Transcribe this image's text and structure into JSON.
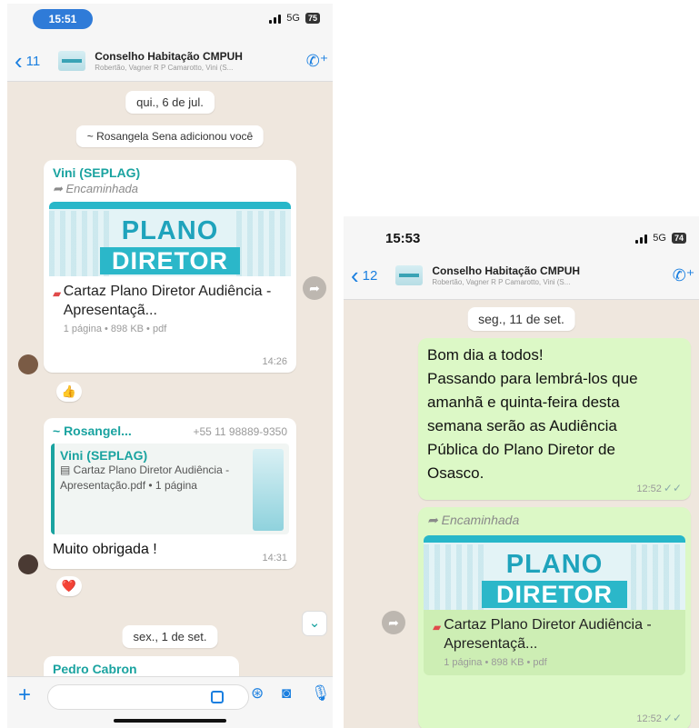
{
  "left": {
    "status": {
      "time": "15:51",
      "network": "5G",
      "battery": "75"
    },
    "header": {
      "back_count": "11",
      "group_name": "Conselho Habitação CMPUH",
      "members": "Robertão, Vagner R P Camarotto, Vini (S..."
    },
    "date_pill_1": "qui., 6 de jul.",
    "system_msg": "~ Rosangela Sena adicionou você",
    "msg1": {
      "sender": "Vini (SEPLAG)",
      "forwarded": "Encaminhada",
      "poster_line1": "PLANO",
      "poster_line2": "DIRETOR",
      "doc_title": "Cartaz Plano Diretor Audiência - Apresentaçã...",
      "doc_meta": "1 página • 898 KB • pdf",
      "time": "14:26",
      "reaction": "👍"
    },
    "msg2": {
      "sender": "~ Rosangel...",
      "phone": "+55 11 98889-9350",
      "quote_author": "Vini (SEPLAG)",
      "quote_text": "Cartaz Plano Diretor Audiência - Apresentação.pdf • 1 página",
      "text": "Muito obrigada !",
      "time": "14:31",
      "reaction": "❤️"
    },
    "date_pill_2": "sex., 1 de set.",
    "partial_msg": "Pedro Cabron"
  },
  "right": {
    "status": {
      "time": "15:53",
      "network": "5G",
      "battery": "74"
    },
    "header": {
      "back_count": "12",
      "group_name": "Conselho Habitação CMPUH",
      "members": "Robertão, Vagner R P Camarotto, Vini (S..."
    },
    "date_pill": "seg., 11 de set.",
    "msg1": {
      "lines": [
        "Bom dia a todos!",
        "Passando para lembrá-los que",
        "amanhã e quinta-feira desta",
        "semana serão as Audiência",
        "Pública do Plano Diretor de",
        "Osasco."
      ],
      "time": "12:52"
    },
    "msg2": {
      "forwarded": "Encaminhada",
      "poster_line1": "PLANO",
      "poster_line2": "DIRETOR",
      "doc_title": "Cartaz Plano Diretor Audiência - Apresentaçã...",
      "doc_meta": "1 página • 898 KB • pdf",
      "time": "12:52"
    }
  },
  "colors": {
    "outgoing_bubble": "#dcf8c6",
    "chat_bg": "#efe7de",
    "accent": "#1a7fe0",
    "sender": "#1aa3a0",
    "time_pill": "#2f7bd8"
  },
  "icons": [
    "back-chevron-icon",
    "add-call-icon",
    "forward-arrow-icon",
    "pdf-icon",
    "share-icon",
    "scroll-down-icon",
    "plus-icon",
    "sticker-icon",
    "payment-icon",
    "camera-icon",
    "microphone-icon",
    "read-ticks-icon"
  ]
}
